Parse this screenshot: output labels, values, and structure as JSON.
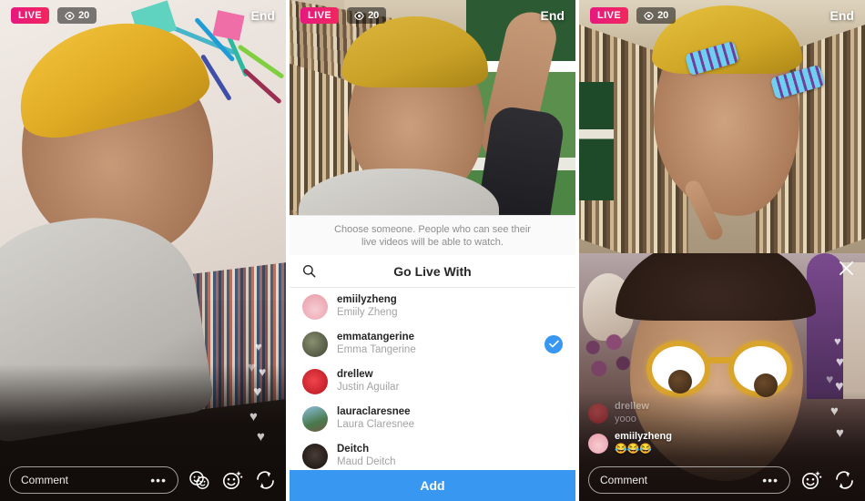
{
  "app": "Instagram Live",
  "panels": [
    {
      "id": "panel-solo-live",
      "top_bar": {
        "live_label": "LIVE",
        "viewer_count": "20",
        "viewer_icon": "eye-icon",
        "end_label": "End"
      },
      "bottom_bar": {
        "comment_placeholder": "Comment",
        "more_dots": "•••",
        "icons": [
          "go-live-with-icon",
          "effects-icon",
          "camera-flip-icon"
        ]
      },
      "hearts": "♥"
    },
    {
      "id": "panel-go-live-with",
      "top_bar": {
        "live_label": "LIVE",
        "viewer_count": "20",
        "viewer_icon": "eye-icon",
        "end_label": "End"
      },
      "hint_line1": "Choose someone. People who can see their",
      "hint_line2": "live videos will be able to watch.",
      "sheet_title": "Go Live With",
      "search_icon": "search-icon",
      "users": [
        {
          "username": "emiilyzheng",
          "fullname": "Emiily Zheng",
          "selected": false,
          "avatar_color": "#f2b8c0"
        },
        {
          "username": "emmatangerine",
          "fullname": "Emma Tangerine",
          "selected": true,
          "avatar_color": "#4e6246"
        },
        {
          "username": "drellew",
          "fullname": "Justin Aguilar",
          "selected": false,
          "avatar_color": "#d81c25"
        },
        {
          "username": "lauraclaresnee",
          "fullname": "Laura Claresnee",
          "selected": false,
          "avatar_color": "#6b9bbf"
        },
        {
          "username": "Deitch",
          "fullname": "Maud Deitch",
          "selected": false,
          "avatar_color": "#2b2220"
        }
      ],
      "add_label": "Add"
    },
    {
      "id": "panel-live-together",
      "top_bar": {
        "live_label": "LIVE",
        "viewer_count": "20",
        "viewer_icon": "eye-icon",
        "end_label": "End"
      },
      "close_icon": "close-icon",
      "comments": [
        {
          "username": "drellew",
          "text": "yooo",
          "faded": true,
          "avatar_color": "#d81c25"
        },
        {
          "username": "emiilyzheng",
          "text": "😂😂😂",
          "faded": false,
          "avatar_color": "#f2b8c0"
        }
      ],
      "bottom_bar": {
        "comment_placeholder": "Comment",
        "more_dots": "•••",
        "icons": [
          "effects-icon",
          "camera-flip-icon"
        ]
      },
      "hearts": "♥"
    }
  ],
  "colors": {
    "live_pink": "#e6187f",
    "accent_blue": "#3897f0",
    "white": "#ffffff",
    "muted": "#8e8e8e"
  }
}
